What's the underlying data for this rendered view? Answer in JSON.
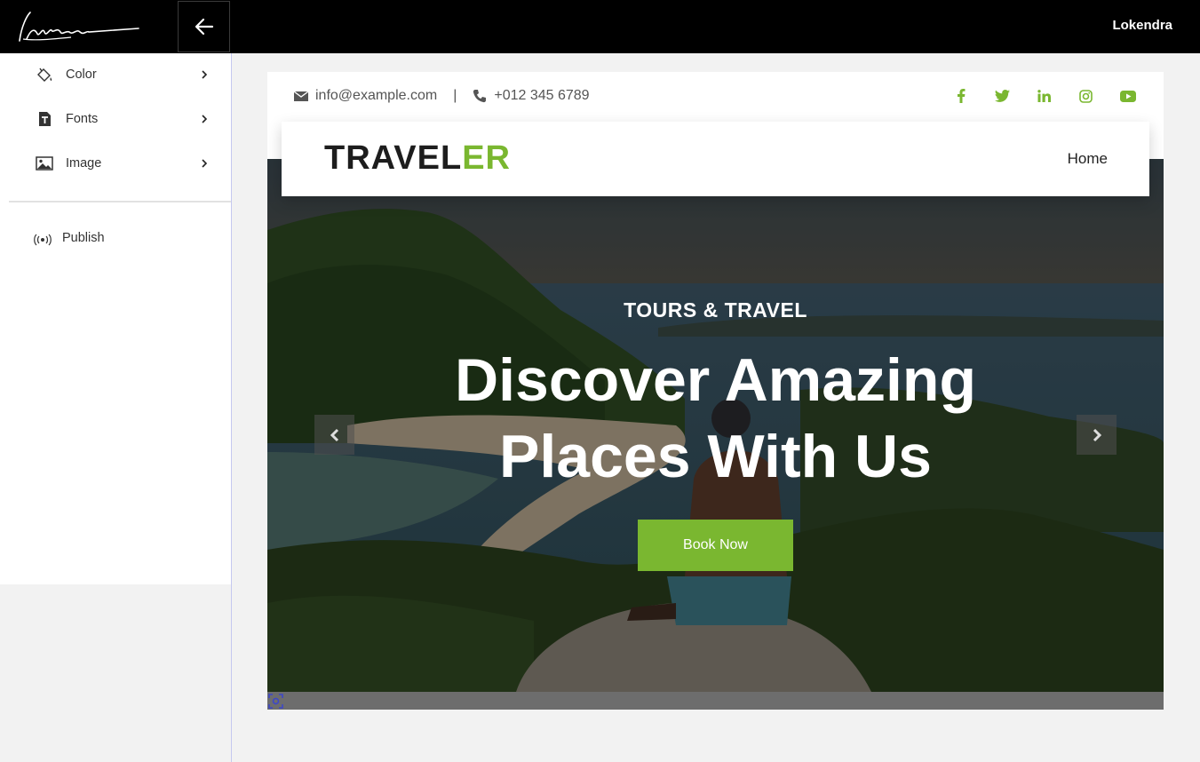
{
  "topbar": {
    "username": "Lokendra",
    "signature_logo": "Lokendra signature logo",
    "back_icon": "arrow-left-icon"
  },
  "sidebar": {
    "items": [
      {
        "label": "Color",
        "icon": "paint-bucket-icon"
      },
      {
        "label": "Fonts",
        "icon": "font-icon"
      },
      {
        "label": "Image",
        "icon": "image-icon"
      }
    ],
    "publish_label": "Publish",
    "publish_icon": "broadcast-icon"
  },
  "site": {
    "email": "info@example.com",
    "separator": "|",
    "phone": "+012 345 6789",
    "socials": [
      "facebook-icon",
      "twitter-icon",
      "linkedin-icon",
      "instagram-icon",
      "youtube-icon"
    ],
    "brand_part1": "TRAVEL",
    "brand_part2": "ER",
    "nav_home": "Home",
    "hero_kicker": "TOURS & TRAVEL",
    "hero_title_line1": "Discover Amazing",
    "hero_title_line2": "Places With Us",
    "cta_label": "Book Now",
    "accent_color": "#7ab730"
  }
}
